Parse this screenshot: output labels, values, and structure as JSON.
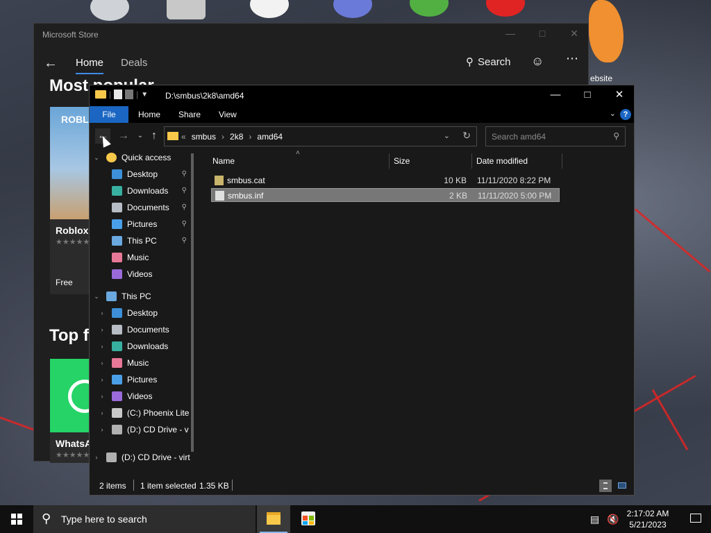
{
  "store": {
    "title": "Microsoft Store",
    "tabs": [
      "Home",
      "Deals"
    ],
    "search_label": "Search",
    "heading_popular": "Most popular",
    "heading_top": "Top fr",
    "cards": [
      {
        "name": "Roblox",
        "image_text": "ROBLO",
        "stars": "★★★★★",
        "price": "Free"
      },
      {
        "name": "WhatsA",
        "stars": "★★★★★"
      }
    ]
  },
  "desktop": {
    "label": "ebsite"
  },
  "explorer": {
    "title": "D:\\smbus\\2k8\\amd64",
    "ribbon_tabs": [
      "File",
      "Home",
      "Share",
      "View"
    ],
    "address": {
      "overflow": "«",
      "crumbs": [
        "smbus",
        "2k8",
        "amd64"
      ]
    },
    "search_placeholder": "Search amd64",
    "columns": {
      "name": "Name",
      "size": "Size",
      "date": "Date modified"
    },
    "nav": [
      {
        "label": "Quick access",
        "icon": "star-icon",
        "level": 0,
        "expand": "⌄",
        "pinned": false
      },
      {
        "label": "Desktop",
        "icon": "desktop-icon",
        "level": 1,
        "expand": "",
        "pinned": true
      },
      {
        "label": "Downloads",
        "icon": "downloads-icon",
        "level": 1,
        "expand": "",
        "pinned": true
      },
      {
        "label": "Documents",
        "icon": "documents-icon",
        "level": 1,
        "expand": "",
        "pinned": true
      },
      {
        "label": "Pictures",
        "icon": "pictures-icon",
        "level": 1,
        "expand": "",
        "pinned": true
      },
      {
        "label": "This PC",
        "icon": "this-pc-icon",
        "level": 1,
        "expand": "",
        "pinned": true
      },
      {
        "label": "Music",
        "icon": "music-icon",
        "level": 1,
        "expand": "",
        "pinned": false
      },
      {
        "label": "Videos",
        "icon": "videos-icon",
        "level": 1,
        "expand": "",
        "pinned": false
      },
      {
        "label": "This PC",
        "icon": "this-pc-icon",
        "level": 0,
        "expand": "⌄",
        "pinned": false
      },
      {
        "label": "Desktop",
        "icon": "desktop-icon",
        "level": 1,
        "expand": "›",
        "pinned": false
      },
      {
        "label": "Documents",
        "icon": "documents-icon",
        "level": 1,
        "expand": "›",
        "pinned": false
      },
      {
        "label": "Downloads",
        "icon": "downloads-icon",
        "level": 1,
        "expand": "›",
        "pinned": false
      },
      {
        "label": "Music",
        "icon": "music-icon",
        "level": 1,
        "expand": "›",
        "pinned": false
      },
      {
        "label": "Pictures",
        "icon": "pictures-icon",
        "level": 1,
        "expand": "›",
        "pinned": false
      },
      {
        "label": "Videos",
        "icon": "videos-icon",
        "level": 1,
        "expand": "›",
        "pinned": false
      },
      {
        "label": "(C:) Phoenix Lite",
        "icon": "drive-icon",
        "level": 1,
        "expand": "›",
        "pinned": false
      },
      {
        "label": "(D:) CD Drive - v",
        "icon": "cd-drive-icon",
        "level": 1,
        "expand": "›",
        "pinned": false
      },
      {
        "label": "(D:) CD Drive - virt",
        "icon": "cd-drive-icon",
        "level": 0,
        "expand": "›",
        "pinned": false
      }
    ],
    "files": [
      {
        "name": "smbus.cat",
        "size": "10 KB",
        "date": "11/11/2020 8:22 PM",
        "icon": "catalog-file-icon",
        "selected": false
      },
      {
        "name": "smbus.inf",
        "size": "2 KB",
        "date": "11/11/2020 5:00 PM",
        "icon": "inf-file-icon",
        "selected": true
      }
    ],
    "status": {
      "items": "2 items",
      "selected": "1 item selected",
      "size": "1.35 KB"
    }
  },
  "taskbar": {
    "search_placeholder": "Type here to search",
    "time": "2:17:02 AM",
    "date": "5/21/2023"
  },
  "colors": {
    "accent": "#1a66c2",
    "folder": "#f8c84a",
    "selection": "#777777"
  }
}
